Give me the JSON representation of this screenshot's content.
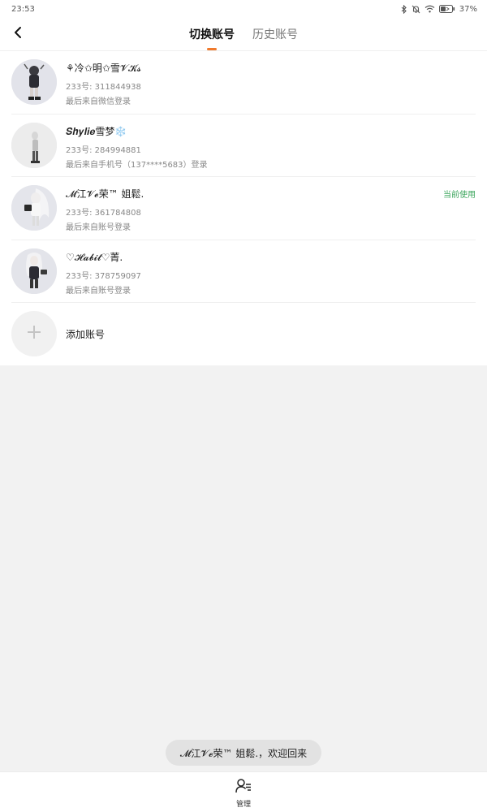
{
  "status_bar": {
    "time": "23:53",
    "battery": "37%"
  },
  "header": {
    "tabs": [
      {
        "label": "切换账号",
        "active": true
      },
      {
        "label": "历史账号",
        "active": false
      }
    ]
  },
  "accounts": [
    {
      "name": "⚘冷✩明✩雪𝓥𝓚𝓼",
      "id": "233号: 311844938",
      "login": "最后来自微信登录",
      "current": ""
    },
    {
      "name": "𝑺𝒉𝒚𝒍𝒊𝒆雪梦❄️",
      "id": "233号: 284994881",
      "login": "最后来自手机号（137****5683）登录",
      "current": ""
    },
    {
      "name": "𝓜江𝓥𝓮荣™ 姐鬆.",
      "id": "233号: 361784808",
      "login": "最后来自账号登录",
      "current": "当前使用"
    },
    {
      "name": "♡𝓗𝓪𝓫𝓲𝓽♡菁.",
      "id": "233号: 378759097",
      "login": "最后来自账号登录",
      "current": ""
    }
  ],
  "add_account": {
    "label": "添加账号"
  },
  "toast": {
    "text": "𝓜江𝓥𝓮荣™ 姐鬆.，欢迎回来"
  },
  "bottom_bar": {
    "manage_label": "管理"
  },
  "colors": {
    "accent": "#f07a2d",
    "current_tag": "#3aa55b"
  }
}
